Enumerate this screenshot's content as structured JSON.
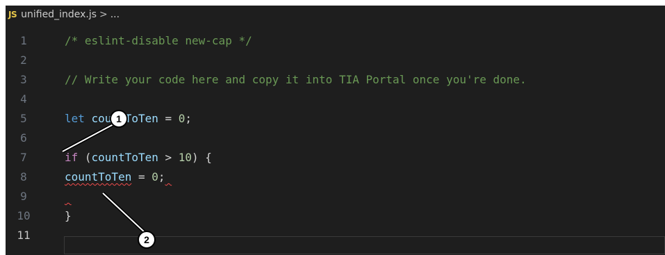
{
  "breadcrumb": {
    "icon_label": "JS",
    "file": "unified_index.js",
    "separator": ">",
    "trail": "..."
  },
  "lines": [
    {
      "num": "1",
      "tokens": [
        {
          "t": "/* eslint-disable new-cap */",
          "c": "comment"
        }
      ]
    },
    {
      "num": "2",
      "tokens": []
    },
    {
      "num": "3",
      "tokens": [
        {
          "t": "// Write your code here and copy it into TIA Portal once you're done.",
          "c": "comment"
        }
      ]
    },
    {
      "num": "4",
      "tokens": []
    },
    {
      "num": "5",
      "tokens": [
        {
          "t": "let ",
          "c": "kw"
        },
        {
          "t": "countToTen",
          "c": "var"
        },
        {
          "t": " = ",
          "c": "txt"
        },
        {
          "t": "0",
          "c": "num"
        },
        {
          "t": ";",
          "c": "txt"
        }
      ]
    },
    {
      "num": "6",
      "tokens": []
    },
    {
      "num": "7",
      "tokens": [
        {
          "t": "if",
          "c": "ctl"
        },
        {
          "t": " (",
          "c": "txt"
        },
        {
          "t": "countToTen",
          "c": "var"
        },
        {
          "t": " > ",
          "c": "txt"
        },
        {
          "t": "10",
          "c": "num"
        },
        {
          "t": ") {",
          "c": "txt"
        }
      ]
    },
    {
      "num": "8",
      "tokens": [
        {
          "t": "countToTen",
          "c": "var squiggle"
        },
        {
          "t": " = ",
          "c": "txt"
        },
        {
          "t": "0",
          "c": "num"
        },
        {
          "t": ";",
          "c": "txt"
        },
        {
          "t": " ",
          "c": "txt squiggle"
        }
      ]
    },
    {
      "num": "9",
      "tokens": [
        {
          "t": " ",
          "c": "txt squiggle"
        }
      ]
    },
    {
      "num": "10",
      "tokens": [
        {
          "t": "}",
          "c": "txt"
        }
      ]
    },
    {
      "num": "11",
      "tokens": []
    }
  ],
  "active_line": "11",
  "callouts": [
    {
      "label": "1"
    },
    {
      "label": "2"
    }
  ],
  "colors": {
    "editor_bg": "#1e1e1e",
    "comment": "#6a9955",
    "keyword": "#569cd6",
    "control": "#c586c0",
    "variable": "#9cdcfe",
    "number": "#b5cea8",
    "error_squiggle": "#f14c4c"
  }
}
